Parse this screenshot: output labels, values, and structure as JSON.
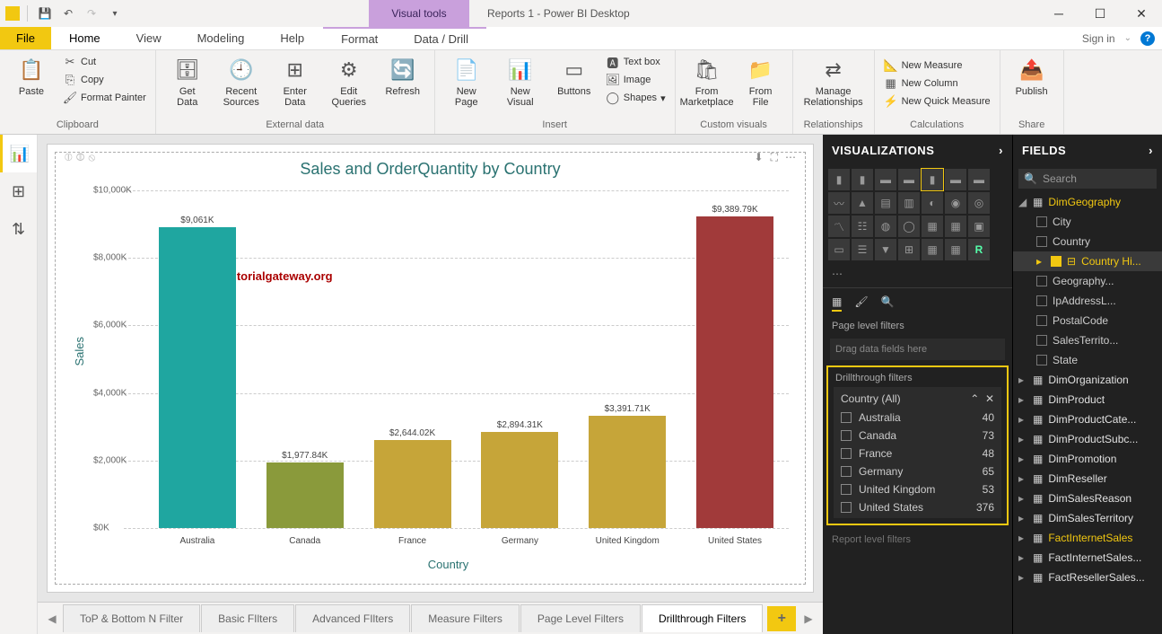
{
  "titlebar": {
    "contextual": "Visual tools",
    "title": "Reports 1 - Power BI Desktop",
    "signin": "Sign in"
  },
  "menus": {
    "file": "File",
    "home": "Home",
    "view": "View",
    "modeling": "Modeling",
    "help": "Help",
    "format": "Format",
    "datadrill": "Data / Drill"
  },
  "ribbon": {
    "clipboard": {
      "label": "Clipboard",
      "paste": "Paste",
      "cut": "Cut",
      "copy": "Copy",
      "format_painter": "Format Painter"
    },
    "external": {
      "label": "External data",
      "get": "Get\nData",
      "recent": "Recent\nSources",
      "enter": "Enter\nData",
      "edit": "Edit\nQueries",
      "refresh": "Refresh"
    },
    "insert": {
      "label": "Insert",
      "newpage": "New\nPage",
      "newvisual": "New\nVisual",
      "buttons": "Buttons",
      "textbox": "Text box",
      "image": "Image",
      "shapes": "Shapes"
    },
    "custom": {
      "label": "Custom visuals",
      "marketplace": "From\nMarketplace",
      "file": "From\nFile"
    },
    "rel": {
      "label": "Relationships",
      "manage": "Manage\nRelationships"
    },
    "calc": {
      "label": "Calculations",
      "newmeasure": "New Measure",
      "newcolumn": "New Column",
      "newquick": "New Quick Measure"
    },
    "share": {
      "label": "Share",
      "publish": "Publish"
    }
  },
  "chart_data": {
    "type": "bar",
    "title": "Sales and OrderQuantity by Country",
    "xlabel": "Country",
    "ylabel": "Sales",
    "ylim": [
      0,
      10000
    ],
    "yticks": [
      "$0K",
      "$2,000K",
      "$4,000K",
      "$6,000K",
      "$8,000K",
      "$10,000K"
    ],
    "categories": [
      "Australia",
      "Canada",
      "France",
      "Germany",
      "United Kingdom",
      "United States"
    ],
    "values": [
      9061,
      1977.84,
      2644.02,
      2894.31,
      3391.71,
      9389.79
    ],
    "value_labels": [
      "$9,061K",
      "$1,977.84K",
      "$2,644.02K",
      "$2,894.31K",
      "$3,391.71K",
      "$9,389.79K"
    ],
    "colors": [
      "#1fa6a0",
      "#8a9a3b",
      "#c6a539",
      "#c6a539",
      "#c6a539",
      "#a13a3a"
    ],
    "watermark": "©tutorialgateway.org"
  },
  "tabs": {
    "pages": [
      "ToP & Bottom N Filter",
      "Basic FIlters",
      "Advanced FIlters",
      "Measure Filters",
      "Page Level Filters",
      "Drillthrough Filters"
    ],
    "active": 5
  },
  "viz": {
    "header": "VISUALIZATIONS",
    "page_filters": "Page level filters",
    "drag_hint": "Drag data fields here",
    "drill_header": "Drillthrough filters",
    "country_filter": "Country  (All)",
    "countries": [
      {
        "name": "Australia",
        "count": 40
      },
      {
        "name": "Canada",
        "count": 73
      },
      {
        "name": "France",
        "count": 48
      },
      {
        "name": "Germany",
        "count": 65
      },
      {
        "name": "United Kingdom",
        "count": 53
      },
      {
        "name": "United States",
        "count": 376
      }
    ],
    "report_filters": "Report level filters"
  },
  "fields": {
    "header": "FIELDS",
    "search": "Search",
    "dimgeo": "DimGeography",
    "dimgeo_cols": [
      "City",
      "Country",
      "Country Hi...",
      "Geography...",
      "IpAddressL...",
      "PostalCode",
      "SalesTerrito...",
      "State"
    ],
    "dimgeo_checked": 2,
    "tables": [
      "DimOrganization",
      "DimProduct",
      "DimProductCate...",
      "DimProductSubc...",
      "DimPromotion",
      "DimReseller",
      "DimSalesReason",
      "DimSalesTerritory",
      "FactInternetSales",
      "FactInternetSales...",
      "FactResellerSales..."
    ],
    "highlighted": 8
  }
}
